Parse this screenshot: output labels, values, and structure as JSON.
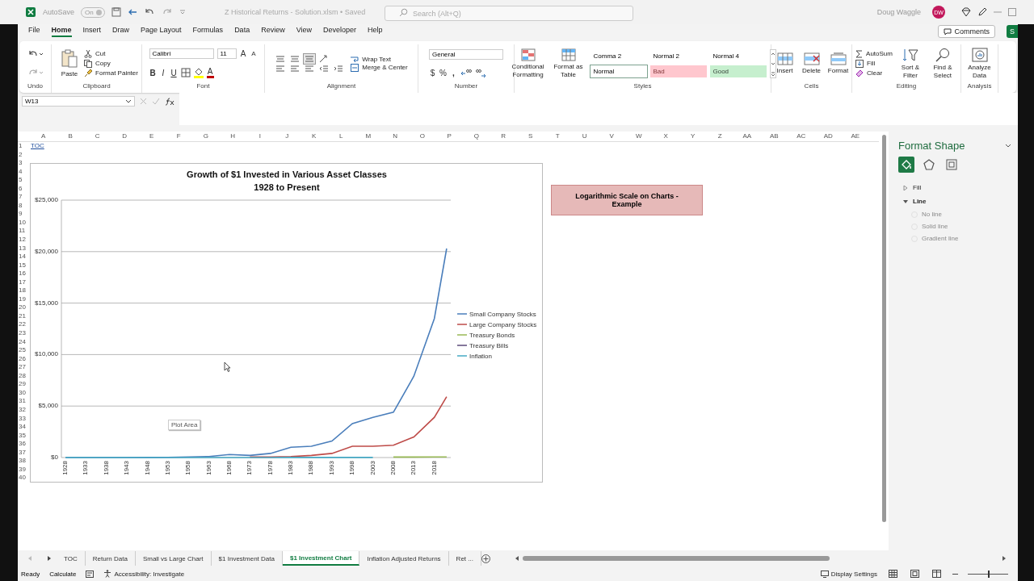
{
  "title_bar": {
    "autosave_label": "AutoSave",
    "autosave_toggle": {
      "label": "On",
      "on": true
    },
    "file_name": "Z Historical Returns - Solution.xlsm • Saved",
    "search": {
      "placeholder": "Search (Alt+Q)"
    },
    "user_name": "Doug Waggle",
    "avatar_initials": "DW"
  },
  "menu_tabs": [
    {
      "label": "File",
      "selected": false
    },
    {
      "label": "Home",
      "selected": true
    },
    {
      "label": "Insert",
      "selected": false
    },
    {
      "label": "Draw",
      "selected": false
    },
    {
      "label": "Page Layout",
      "selected": false
    },
    {
      "label": "Formulas",
      "selected": false
    },
    {
      "label": "Data",
      "selected": false
    },
    {
      "label": "Review",
      "selected": false
    },
    {
      "label": "View",
      "selected": false
    },
    {
      "label": "Developer",
      "selected": false
    },
    {
      "label": "Help",
      "selected": false
    }
  ],
  "comments_button": "Comments",
  "share_button": "S",
  "ribbon": {
    "undo": {
      "group_label": "Undo"
    },
    "clipboard": {
      "group_label": "Clipboard",
      "paste": "Paste",
      "cut": "Cut",
      "copy": "Copy",
      "format_painter": "Format Painter"
    },
    "font": {
      "group_label": "Font",
      "font_name": "Calibri",
      "font_size": "11",
      "grow_font": "A",
      "shrink_font": "A",
      "bold": "B",
      "italic": "I",
      "underline": "U",
      "font_color": "A"
    },
    "alignment": {
      "group_label": "Alignment",
      "wrap_text": "Wrap Text",
      "merge_center": "Merge & Center"
    },
    "number": {
      "group_label": "Number",
      "format": "General",
      "currency": "$",
      "percent": "%",
      "comma": ","
    },
    "styles": {
      "group_label": "Styles",
      "conditional_formatting": "Conditional Formatting",
      "format_as_table": "Format as Table",
      "cell_styles": [
        {
          "label": "Comma 2",
          "selected": false,
          "color": "#ffffff"
        },
        {
          "label": "Normal 2",
          "selected": false,
          "color": "#ffffff"
        },
        {
          "label": "Normal 4",
          "selected": false,
          "color": "#ffffff"
        },
        {
          "label": "Normal",
          "selected": true,
          "color": "#ffffff"
        },
        {
          "label": "Bad",
          "selected": false,
          "color": "#ffc7ce"
        },
        {
          "label": "Good",
          "selected": false,
          "color": "#c6efce"
        }
      ]
    },
    "cells": {
      "group_label": "Cells",
      "insert": "Insert",
      "delete": "Delete",
      "format": "Format"
    },
    "editing": {
      "group_label": "Editing",
      "autosum": "AutoSum",
      "fill": "Fill",
      "clear": "Clear",
      "sort_filter": "Sort & Filter",
      "find_select": "Find & Select"
    },
    "analysis": {
      "group_label": "Analysis",
      "analyze_data": "Analyze Data"
    }
  },
  "formula_bar": {
    "name_box": "W13"
  },
  "sheet": {
    "columns": [
      "A",
      "B",
      "C",
      "D",
      "E",
      "F",
      "G",
      "H",
      "I",
      "J",
      "K",
      "L",
      "M",
      "N",
      "O",
      "P",
      "Q",
      "R",
      "S",
      "T",
      "U",
      "V",
      "W",
      "X",
      "Y",
      "Z",
      "AA",
      "AB",
      "AC",
      "AD",
      "AE"
    ],
    "rows": [
      "1",
      "2",
      "3",
      "4",
      "5",
      "6",
      "7",
      "8",
      "9",
      "10",
      "11",
      "12",
      "13",
      "14",
      "15",
      "16",
      "17",
      "18",
      "19",
      "20",
      "21",
      "22",
      "23",
      "24",
      "25",
      "26",
      "27",
      "28",
      "29",
      "30",
      "31",
      "32",
      "33",
      "34",
      "35",
      "36",
      "37",
      "38",
      "39",
      "40"
    ],
    "toc_link": "TOC"
  },
  "chart": {
    "subtitle": "1928 to Present",
    "tooltip": "Plot Area",
    "chart_data": {
      "type": "line",
      "title": "Growth of $1 Invested in Various Asset Classes",
      "x": [
        1928,
        1933,
        1938,
        1943,
        1948,
        1953,
        1958,
        1963,
        1968,
        1973,
        1978,
        1983,
        1988,
        1993,
        1998,
        2003,
        2008,
        2013,
        2018,
        2021
      ],
      "xlim": [
        1927,
        2022
      ],
      "ylim": [
        0,
        25000
      ],
      "grid": true,
      "legend": "right",
      "xticks": [
        1928,
        1933,
        1938,
        1943,
        1948,
        1953,
        1958,
        1963,
        1968,
        1973,
        1978,
        1983,
        1988,
        1993,
        1998,
        2003,
        2008,
        2013,
        2018
      ],
      "yticks": [
        {
          "value": 0,
          "label": "$0"
        },
        {
          "value": 5000,
          "label": "$5,000"
        },
        {
          "value": 10000,
          "label": "$10,000"
        },
        {
          "value": 15000,
          "label": "$15,000"
        },
        {
          "value": 20000,
          "label": "$20,000"
        },
        {
          "value": 25000,
          "label": "$25,000"
        }
      ],
      "series": [
        {
          "name": "Small Company Stocks",
          "color": "#4a7ebb",
          "values": [
            0,
            0,
            0,
            0,
            10,
            20,
            60,
            100,
            300,
            200,
            400,
            1000,
            1100,
            1600,
            3300,
            3900,
            4400,
            7900,
            13500,
            20300
          ]
        },
        {
          "name": "Large Company Stocks",
          "color": "#be4b48",
          "values": [
            null,
            null,
            null,
            null,
            null,
            null,
            null,
            null,
            null,
            50,
            50,
            100,
            200,
            400,
            1100,
            1100,
            1200,
            2000,
            3900,
            5900
          ]
        },
        {
          "name": "Treasury Bonds",
          "color": "#98b954",
          "values": [
            null,
            null,
            null,
            null,
            null,
            null,
            null,
            null,
            null,
            null,
            null,
            null,
            null,
            null,
            null,
            null,
            50,
            50,
            60,
            60
          ]
        },
        {
          "name": "Treasury Bills",
          "color": "#5b4a7a",
          "values": [
            null,
            null,
            null,
            null,
            null,
            null,
            null,
            null,
            null,
            null,
            null,
            null,
            null,
            null,
            null,
            null,
            null,
            null,
            null,
            null
          ]
        },
        {
          "name": "Inflation",
          "color": "#46aac5",
          "values": [
            0,
            0,
            0,
            0,
            0,
            0,
            0,
            0,
            0,
            0,
            0,
            10,
            10,
            10,
            10,
            10,
            null,
            null,
            null,
            null
          ]
        }
      ]
    }
  },
  "shape": {
    "text": "Logarithmic Scale on Charts - Example"
  },
  "format_pane": {
    "title": "Format Shape",
    "tabs": [
      {
        "selected": true
      },
      {
        "selected": false
      },
      {
        "selected": false
      }
    ],
    "sections": [
      {
        "label": "Fill",
        "expanded": false
      },
      {
        "label": "Line",
        "expanded": true,
        "options": [
          {
            "label": "No line",
            "disabled": true
          },
          {
            "label": "Solid line",
            "disabled": true
          },
          {
            "label": "Gradient line",
            "disabled": true
          }
        ]
      }
    ]
  },
  "sheet_tabs": [
    {
      "label": "TOC",
      "selected": false
    },
    {
      "label": "Return Data",
      "selected": false
    },
    {
      "label": "Small vs Large Chart",
      "selected": false
    },
    {
      "label": "$1 Investment Data",
      "selected": false
    },
    {
      "label": "$1 Investment Chart",
      "selected": true
    },
    {
      "label": "Inflation Adjusted Returns",
      "selected": false
    },
    {
      "label": "Ret ...",
      "selected": false
    }
  ],
  "status_bar": {
    "ready": "Ready",
    "calculate": "Calculate",
    "accessibility": "Accessibility: Investigate",
    "display_settings": "Display Settings",
    "zoom_slider": {
      "level": 0.5
    }
  }
}
